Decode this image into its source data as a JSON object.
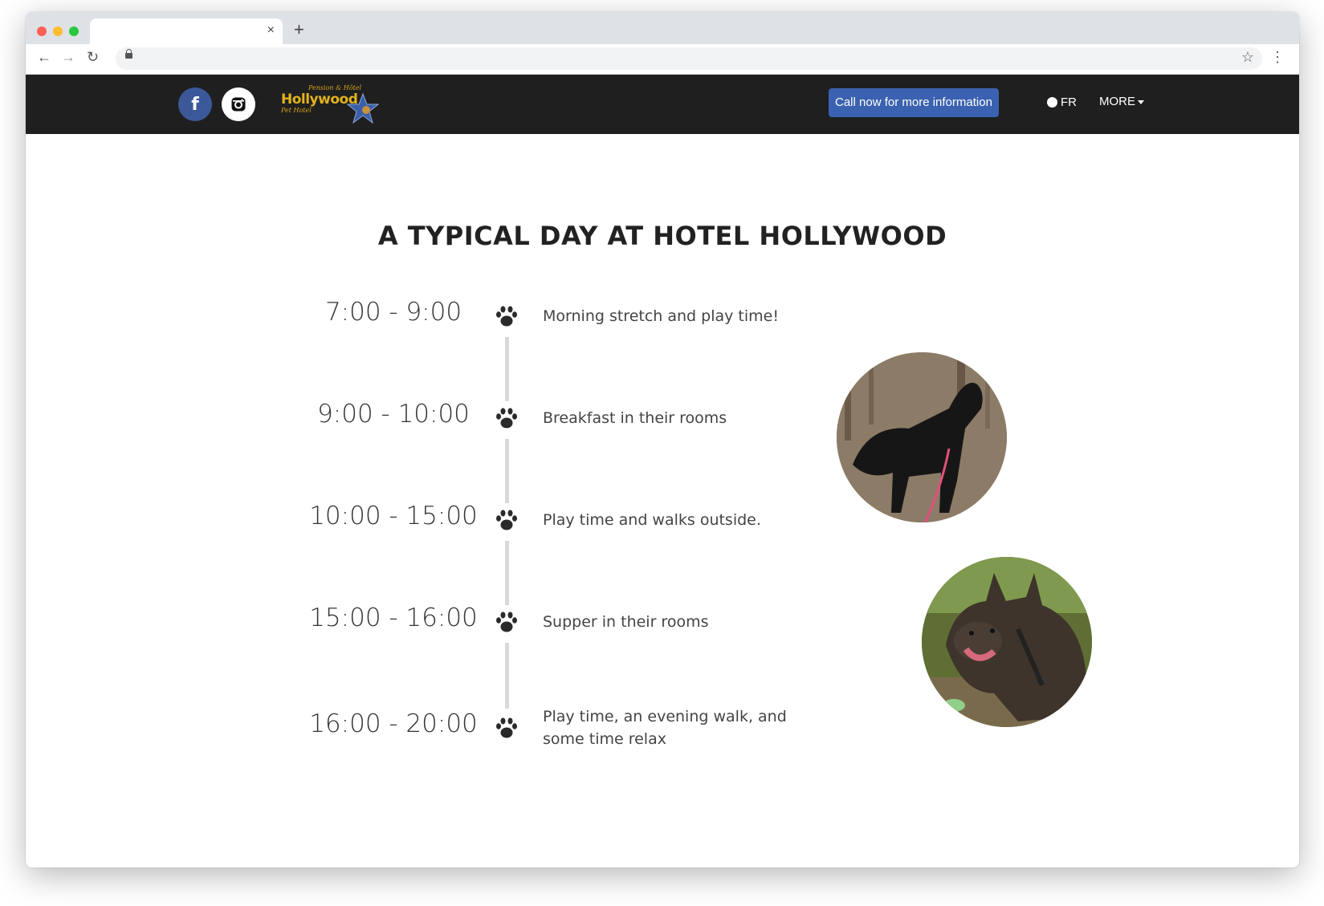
{
  "browser": {
    "tab_close_glyph": "×",
    "new_tab_glyph": "+",
    "back_glyph": "←",
    "forward_glyph": "→",
    "reload_glyph": "↻",
    "bookmark_glyph": "☆",
    "menu_glyph": "⋮"
  },
  "header": {
    "facebook_glyph": "f",
    "logo": {
      "top_text": "Pension & Hôtel",
      "main_text": "Hollywood",
      "sub_text": "Pet Hotel"
    },
    "call_button_label": "Call now for more information",
    "language_label": "FR",
    "more_label": "MORE",
    "colors": {
      "header_bg": "#1f1f1f",
      "button_bg": "#3b62b0",
      "facebook": "#3b5998",
      "logo_gold": "#e2b21d"
    }
  },
  "main": {
    "title": "A TYPICAL DAY AT HOTEL HOLLYWOOD",
    "schedule": [
      {
        "time": "7:00 - 9:00",
        "description": "Morning stretch and play time!"
      },
      {
        "time": "9:00 - 10:00",
        "description": "Breakfast in their rooms"
      },
      {
        "time": "10:00 - 15:00",
        "description": "Play time and walks outside."
      },
      {
        "time": "15:00 - 16:00",
        "description": "Supper in their rooms"
      },
      {
        "time": "16:00 - 20:00",
        "description": "Play time, an evening walk, and some time relax"
      }
    ],
    "icons": [
      "paw-icon"
    ]
  }
}
